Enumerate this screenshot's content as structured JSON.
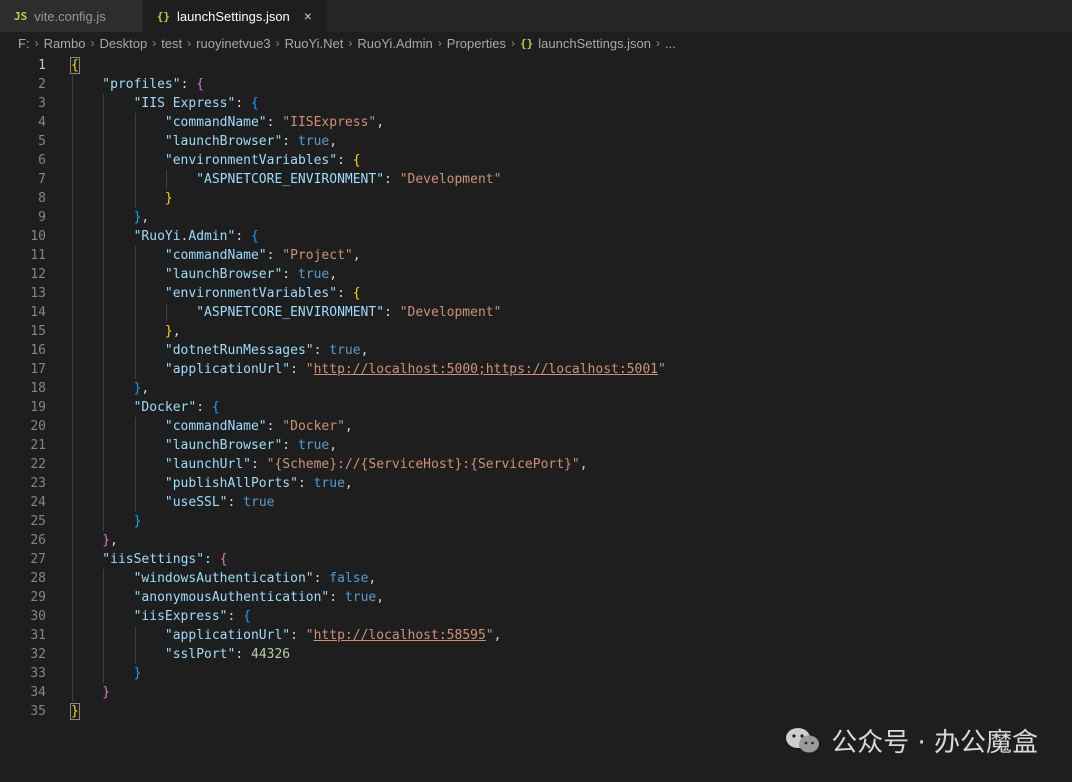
{
  "tabs": [
    {
      "label": "vite.config.js",
      "icon": "JS"
    },
    {
      "label": "launchSettings.json",
      "icon": "{}",
      "close": "×"
    }
  ],
  "breadcrumb": [
    "F:",
    "Rambo",
    "Desktop",
    "test",
    "ruoyinetvue3",
    "RuoYi.Net",
    "RuoYi.Admin",
    "Properties",
    "launchSettings.json",
    "..."
  ],
  "breadcrumb_separator": "›",
  "breadcrumb_file_icon": "{}",
  "line_numbers": [
    "1",
    "2",
    "3",
    "4",
    "5",
    "6",
    "7",
    "8",
    "9",
    "10",
    "11",
    "12",
    "13",
    "14",
    "15",
    "16",
    "17",
    "18",
    "19",
    "20",
    "21",
    "22",
    "23",
    "24",
    "25",
    "26",
    "27",
    "28",
    "29",
    "30",
    "31",
    "32",
    "33",
    "34",
    "35"
  ],
  "code_lines": [
    [
      [
        "b1",
        "{"
      ]
    ],
    [
      [
        "t-key",
        "\"profiles\""
      ],
      [
        "t-p",
        ": "
      ],
      [
        "b2",
        "{"
      ]
    ],
    [
      [
        "t-key",
        "\"IIS Express\""
      ],
      [
        "t-p",
        ": "
      ],
      [
        "b3",
        "{"
      ]
    ],
    [
      [
        "t-key",
        "\"commandName\""
      ],
      [
        "t-p",
        ": "
      ],
      [
        "t-str",
        "\"IISExpress\""
      ],
      [
        "t-p",
        ","
      ]
    ],
    [
      [
        "t-key",
        "\"launchBrowser\""
      ],
      [
        "t-p",
        ": "
      ],
      [
        "t-kw",
        "true"
      ],
      [
        "t-p",
        ","
      ]
    ],
    [
      [
        "t-key",
        "\"environmentVariables\""
      ],
      [
        "t-p",
        ": "
      ],
      [
        "b1",
        "{"
      ]
    ],
    [
      [
        "t-key",
        "\"ASPNETCORE_ENVIRONMENT\""
      ],
      [
        "t-p",
        ": "
      ],
      [
        "t-str",
        "\"Development\""
      ]
    ],
    [
      [
        "b1",
        "}"
      ]
    ],
    [
      [
        "b3",
        "}"
      ],
      [
        "t-p",
        ","
      ]
    ],
    [
      [
        "t-key",
        "\"RuoYi.Admin\""
      ],
      [
        "t-p",
        ": "
      ],
      [
        "b3",
        "{"
      ]
    ],
    [
      [
        "t-key",
        "\"commandName\""
      ],
      [
        "t-p",
        ": "
      ],
      [
        "t-str",
        "\"Project\""
      ],
      [
        "t-p",
        ","
      ]
    ],
    [
      [
        "t-key",
        "\"launchBrowser\""
      ],
      [
        "t-p",
        ": "
      ],
      [
        "t-kw",
        "true"
      ],
      [
        "t-p",
        ","
      ]
    ],
    [
      [
        "t-key",
        "\"environmentVariables\""
      ],
      [
        "t-p",
        ": "
      ],
      [
        "b1",
        "{"
      ]
    ],
    [
      [
        "t-key",
        "\"ASPNETCORE_ENVIRONMENT\""
      ],
      [
        "t-p",
        ": "
      ],
      [
        "t-str",
        "\"Development\""
      ]
    ],
    [
      [
        "b1",
        "}"
      ],
      [
        "t-p",
        ","
      ]
    ],
    [
      [
        "t-key",
        "\"dotnetRunMessages\""
      ],
      [
        "t-p",
        ": "
      ],
      [
        "t-kw",
        "true"
      ],
      [
        "t-p",
        ","
      ]
    ],
    [
      [
        "t-key",
        "\"applicationUrl\""
      ],
      [
        "t-p",
        ": "
      ],
      [
        "t-str",
        "\""
      ],
      [
        "t-url",
        "http://localhost:5000;https://localhost:5001"
      ],
      [
        "t-str",
        "\""
      ]
    ],
    [
      [
        "b3",
        "}"
      ],
      [
        "t-p",
        ","
      ]
    ],
    [
      [
        "t-key",
        "\"Docker\""
      ],
      [
        "t-p",
        ": "
      ],
      [
        "b3",
        "{"
      ]
    ],
    [
      [
        "t-key",
        "\"commandName\""
      ],
      [
        "t-p",
        ": "
      ],
      [
        "t-str",
        "\"Docker\""
      ],
      [
        "t-p",
        ","
      ]
    ],
    [
      [
        "t-key",
        "\"launchBrowser\""
      ],
      [
        "t-p",
        ": "
      ],
      [
        "t-kw",
        "true"
      ],
      [
        "t-p",
        ","
      ]
    ],
    [
      [
        "t-key",
        "\"launchUrl\""
      ],
      [
        "t-p",
        ": "
      ],
      [
        "t-str",
        "\"{Scheme}://{ServiceHost}:{ServicePort}\""
      ],
      [
        "t-p",
        ","
      ]
    ],
    [
      [
        "t-key",
        "\"publishAllPorts\""
      ],
      [
        "t-p",
        ": "
      ],
      [
        "t-kw",
        "true"
      ],
      [
        "t-p",
        ","
      ]
    ],
    [
      [
        "t-key",
        "\"useSSL\""
      ],
      [
        "t-p",
        ": "
      ],
      [
        "t-kw",
        "true"
      ]
    ],
    [
      [
        "b3",
        "}"
      ]
    ],
    [
      [
        "b2",
        "}"
      ],
      [
        "t-p",
        ","
      ]
    ],
    [
      [
        "t-key",
        "\"iisSettings\""
      ],
      [
        "t-p",
        ": "
      ],
      [
        "b2",
        "{"
      ]
    ],
    [
      [
        "t-key",
        "\"windowsAuthentication\""
      ],
      [
        "t-p",
        ": "
      ],
      [
        "t-kw",
        "false"
      ],
      [
        "t-p",
        ","
      ]
    ],
    [
      [
        "t-key",
        "\"anonymousAuthentication\""
      ],
      [
        "t-p",
        ": "
      ],
      [
        "t-kw",
        "true"
      ],
      [
        "t-p",
        ","
      ]
    ],
    [
      [
        "t-key",
        "\"iisExpress\""
      ],
      [
        "t-p",
        ": "
      ],
      [
        "b3",
        "{"
      ]
    ],
    [
      [
        "t-key",
        "\"applicationUrl\""
      ],
      [
        "t-p",
        ": "
      ],
      [
        "t-str",
        "\""
      ],
      [
        "t-url",
        "http://localhost:58595"
      ],
      [
        "t-str",
        "\""
      ],
      [
        "t-p",
        ","
      ]
    ],
    [
      [
        "t-key",
        "\"sslPort\""
      ],
      [
        "t-p",
        ": "
      ],
      [
        "t-num",
        "44326"
      ]
    ],
    [
      [
        "b3",
        "}"
      ]
    ],
    [
      [
        "b2",
        "}"
      ]
    ],
    [
      [
        "b1",
        "}"
      ]
    ]
  ],
  "indent_levels": [
    0,
    1,
    2,
    3,
    3,
    3,
    4,
    3,
    2,
    2,
    3,
    3,
    3,
    4,
    3,
    3,
    3,
    2,
    2,
    3,
    3,
    3,
    3,
    3,
    2,
    1,
    1,
    2,
    2,
    2,
    3,
    3,
    2,
    1,
    0
  ],
  "current_line": 1,
  "watermark": {
    "text": "公众号 · 办公魔盒",
    "icon": "wechat-icon"
  }
}
